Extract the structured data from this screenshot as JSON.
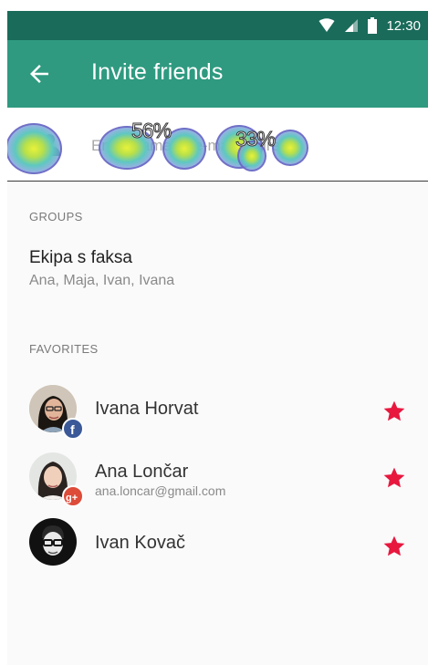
{
  "status_bar": {
    "time": "12:30"
  },
  "app_bar": {
    "title": "Invite friends"
  },
  "search": {
    "placeholder": "Enter name or e-mail address"
  },
  "heatmap": {
    "label_1": "56%",
    "label_2": "33%"
  },
  "groups": {
    "header": "GROUPS",
    "items": [
      {
        "name": "Ekipa s faksa",
        "members": "Ana, Maja, Ivan, Ivana"
      }
    ]
  },
  "favorites": {
    "header": "FAVORITES",
    "items": [
      {
        "name": "Ivana Horvat",
        "email": "",
        "source": "facebook",
        "starred": true
      },
      {
        "name": "Ana Lončar",
        "email": "ana.loncar@gmail.com",
        "source": "google-plus",
        "starred": true
      },
      {
        "name": "Ivan Kovač",
        "email": "",
        "source": "",
        "starred": true
      }
    ]
  },
  "colors": {
    "status_bar": "#1a6b5a",
    "app_bar": "#2f9a80",
    "star": "#e8173e",
    "facebook": "#3b5998",
    "google_plus": "#dd4b39"
  }
}
